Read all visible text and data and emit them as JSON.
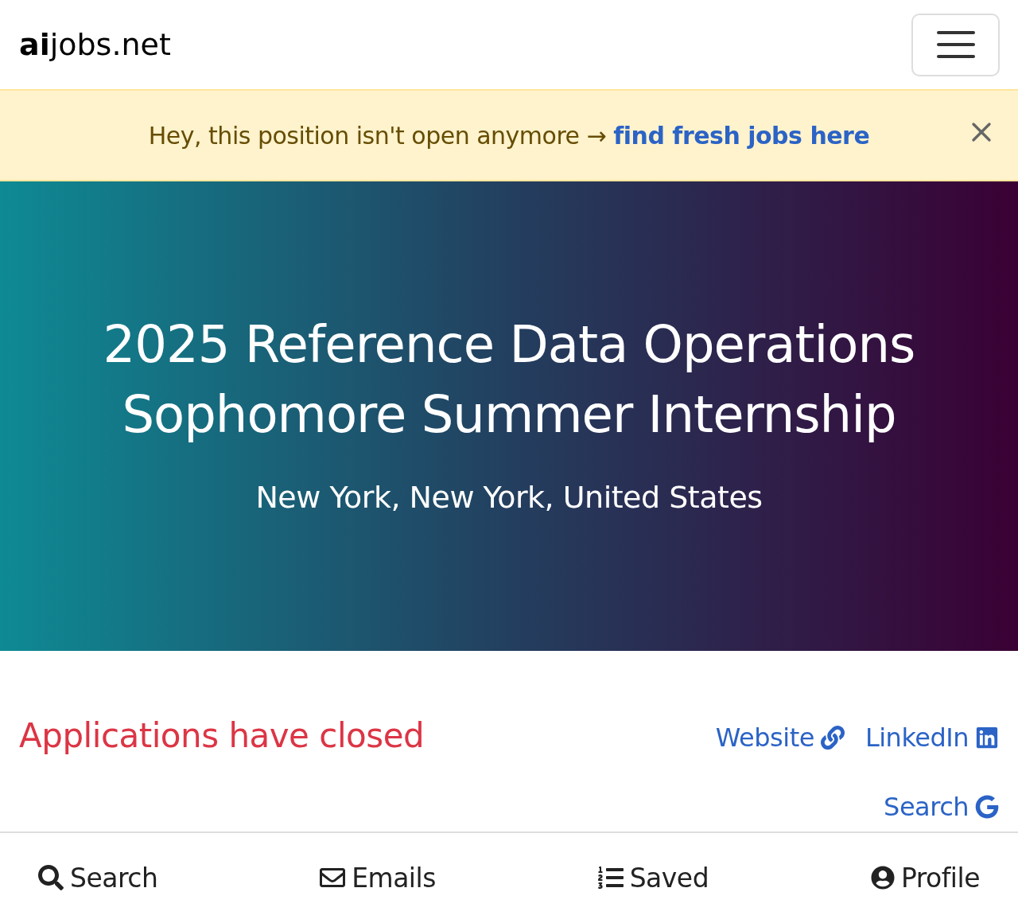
{
  "navbar": {
    "logo": "**ai**jobs.net"
  },
  "alert": {
    "text": "Hey, this position isn't open anymore → ",
    "link": "find fresh jobs here"
  },
  "hero": {
    "title": "2025 Reference Data Operations Sophomore Summer Internship",
    "location": "New York, New York, United States"
  },
  "status": {
    "text": "Applications have closed"
  },
  "links": [
    {
      "kind": "website",
      "label": "Website"
    },
    {
      "kind": "linkedin",
      "label": "LinkedIn"
    },
    {
      "kind": "google",
      "label": "Search"
    }
  ],
  "bottom_nav": [
    {
      "kind": "search",
      "label": "Search"
    },
    {
      "kind": "emails",
      "label": "Emails"
    },
    {
      "kind": "saved",
      "label": "Saved"
    },
    {
      "kind": "profile",
      "label": "Profile"
    }
  ]
}
